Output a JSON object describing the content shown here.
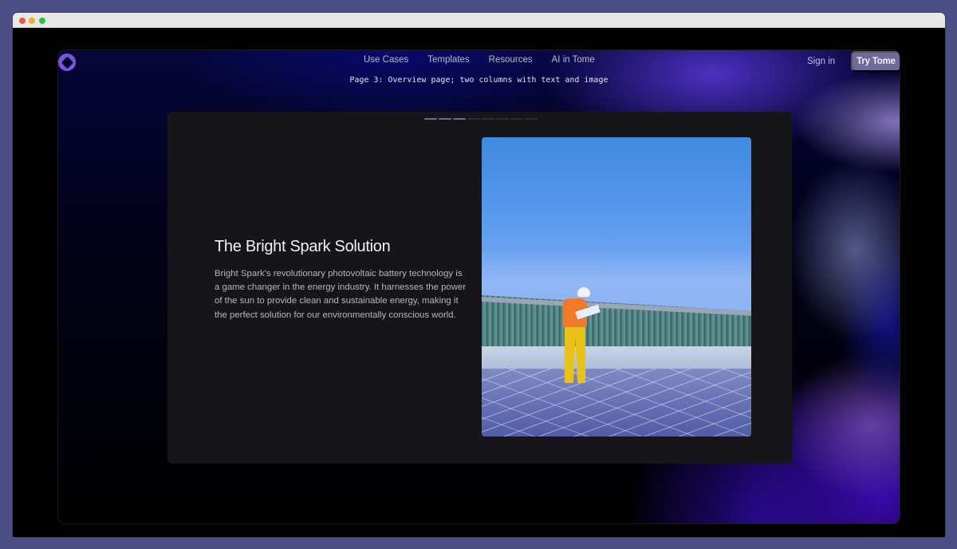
{
  "window": {
    "controls": [
      "close",
      "minimize",
      "maximize"
    ]
  },
  "header": {
    "logo_icon": "tome-logo-icon",
    "nav": [
      {
        "label": "Use Cases"
      },
      {
        "label": "Templates"
      },
      {
        "label": "Resources"
      },
      {
        "label": "AI in Tome"
      }
    ],
    "sign_in_label": "Sign in",
    "cta_label": "Try Tome"
  },
  "caption": "Page 3: Overview page; two columns with text and image",
  "slide": {
    "progress": {
      "total_pages": 8,
      "current_page": 3
    },
    "title": "The Bright Spark Solution",
    "body": "Bright Spark's revolutionary photovoltaic battery technology is a game changer in the energy industry. It harnesses the power of the sun to provide clean and sustainable energy, making it the perfect solution for our environmentally conscious world.",
    "image_description": "Worker in orange shirt, yellow pants and white hard hat reading a document on a rooftop with solar panels under a blue sky"
  },
  "colors": {
    "page_bg": "#4a4e85",
    "slide_bg": "#161519",
    "accent_purple": "#7a55d8",
    "cta_bg": "#6f6a9a"
  }
}
